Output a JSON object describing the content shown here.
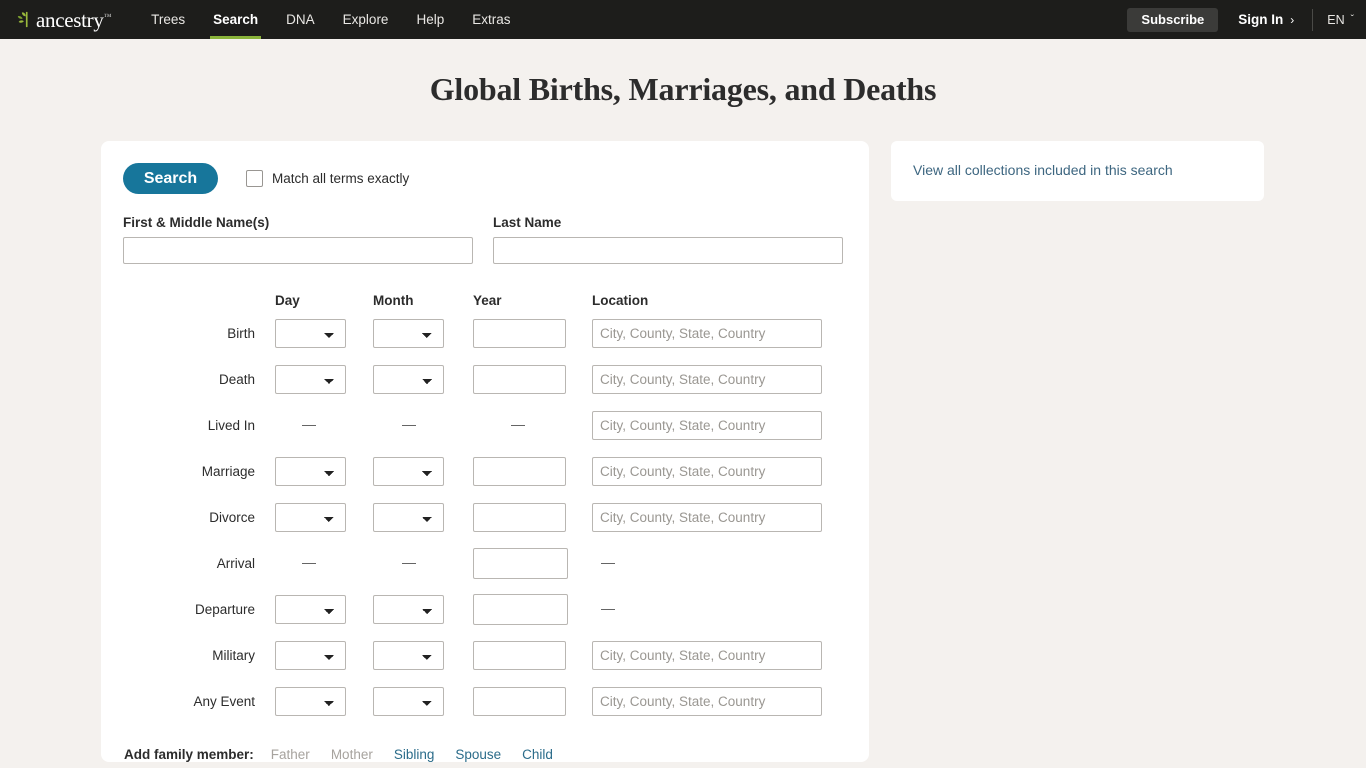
{
  "nav": {
    "brand": {
      "word": "ancestry",
      "tm": "™",
      "leaf_icon": "leaf-icon"
    },
    "links": [
      {
        "label": "Trees",
        "active": false
      },
      {
        "label": "Search",
        "active": true
      },
      {
        "label": "DNA",
        "active": false
      },
      {
        "label": "Explore",
        "active": false
      },
      {
        "label": "Help",
        "active": false
      },
      {
        "label": "Extras",
        "active": false
      }
    ],
    "subscribe_label": "Subscribe",
    "signin_label": "Sign In",
    "signin_chevron": "›",
    "language": "EN",
    "language_caret": "ˇ"
  },
  "page": {
    "title": "Global Births, Marriages, and Deaths"
  },
  "form": {
    "search_button": "Search",
    "match_exactly_label": "Match all terms exactly",
    "match_exactly_checked": false,
    "first_name": {
      "label": "First & Middle Name(s)",
      "value": "",
      "placeholder": ""
    },
    "last_name": {
      "label": "Last Name",
      "value": "",
      "placeholder": ""
    },
    "columns": {
      "day": "Day",
      "month": "Month",
      "year": "Year",
      "location": "Location"
    },
    "location_placeholder": "City, County, State, Country",
    "dash": "—",
    "rows": [
      {
        "label": "Birth",
        "day": "select",
        "month": "select",
        "year": "input",
        "location": "input"
      },
      {
        "label": "Death",
        "day": "select",
        "month": "select",
        "year": "input",
        "location": "input"
      },
      {
        "label": "Lived In",
        "day": "dash",
        "month": "dash",
        "year": "dash",
        "location": "input"
      },
      {
        "label": "Marriage",
        "day": "select",
        "month": "select",
        "year": "input",
        "location": "input"
      },
      {
        "label": "Divorce",
        "day": "select",
        "month": "select",
        "year": "input",
        "location": "input"
      },
      {
        "label": "Arrival",
        "day": "dash",
        "month": "dash",
        "year": "input-wide",
        "location": "dash"
      },
      {
        "label": "Departure",
        "day": "select",
        "month": "select",
        "year": "input-wide",
        "location": "dash"
      },
      {
        "label": "Military",
        "day": "select",
        "month": "select",
        "year": "input",
        "location": "input"
      },
      {
        "label": "Any Event",
        "day": "select",
        "month": "select",
        "year": "input",
        "location": "input"
      }
    ],
    "family": {
      "title": "Add family member:",
      "members": [
        {
          "label": "Father",
          "enabled": false
        },
        {
          "label": "Mother",
          "enabled": false
        },
        {
          "label": "Sibling",
          "enabled": true
        },
        {
          "label": "Spouse",
          "enabled": true
        },
        {
          "label": "Child",
          "enabled": true
        }
      ]
    }
  },
  "sidebar": {
    "collections_link": "View all collections included in this search"
  },
  "colors": {
    "nav_background": "#1d1d1b",
    "page_background": "#f4f1ee",
    "accent_teal": "#17769b",
    "accent_green": "#8ab33a",
    "link_blue": "#2b6c8a"
  }
}
